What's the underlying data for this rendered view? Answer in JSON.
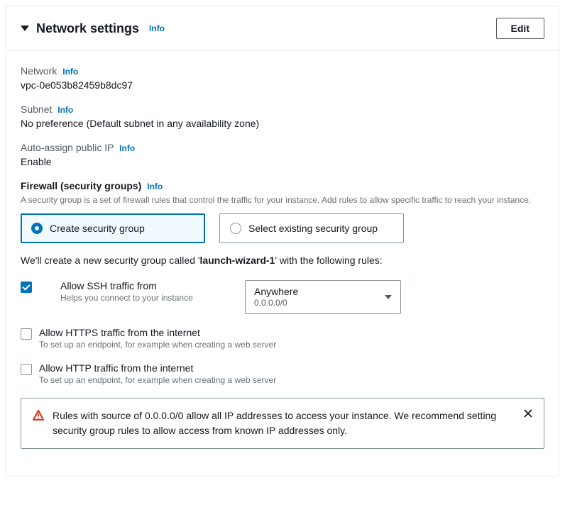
{
  "header": {
    "title": "Network settings",
    "info": "Info",
    "edit": "Edit"
  },
  "network": {
    "label": "Network",
    "info": "Info",
    "value": "vpc-0e053b82459b8dc97"
  },
  "subnet": {
    "label": "Subnet",
    "info": "Info",
    "value": "No preference (Default subnet in any availability zone)"
  },
  "publicIp": {
    "label": "Auto-assign public IP",
    "info": "Info",
    "value": "Enable"
  },
  "firewall": {
    "label": "Firewall (security groups)",
    "info": "Info",
    "desc": "A security group is a set of firewall rules that control the traffic for your instance. Add rules to allow specific traffic to reach your instance.",
    "options": {
      "create": "Create security group",
      "select": "Select existing security group"
    },
    "sgTextPre": "We'll create a new security group called '",
    "sgName": "launch-wizard-1",
    "sgTextPost": "' with the following rules:"
  },
  "rules": {
    "ssh": {
      "label": "Allow SSH traffic from",
      "desc": "Helps you connect to your instance",
      "selectMain": "Anywhere",
      "selectSub": "0.0.0.0/0"
    },
    "https": {
      "label": "Allow HTTPS traffic from the internet",
      "desc": "To set up an endpoint, for example when creating a web server"
    },
    "http": {
      "label": "Allow HTTP traffic from the internet",
      "desc": "To set up an endpoint, for example when creating a web server"
    }
  },
  "alert": {
    "text": "Rules with source of 0.0.0.0/0 allow all IP addresses to access your instance. We recommend setting security group rules to allow access from known IP addresses only."
  }
}
